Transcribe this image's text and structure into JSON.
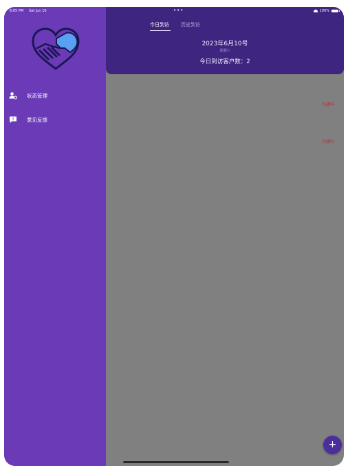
{
  "status_bar": {
    "time": "6:05 PM",
    "date": "Sat Jun 10",
    "dots": "•••",
    "battery": "100%"
  },
  "drawer": {
    "menu": [
      {
        "label": "状态管理",
        "icon": "user-settings-icon"
      },
      {
        "label": "意见反馈",
        "icon": "feedback-icon"
      }
    ],
    "logo_icon": "handshake-heart-icon"
  },
  "header": {
    "tabs": [
      {
        "label": "今日到访",
        "active": true
      },
      {
        "label": "历史到访",
        "active": false
      }
    ],
    "date": "2023年6月10号",
    "weekday": "星期六",
    "count_text": "今日到访客户数：2"
  },
  "list": {
    "items": [
      {
        "status": "沟通中"
      },
      {
        "status": "沟通中"
      }
    ]
  },
  "fab": {
    "label": "+"
  },
  "colors": {
    "drawer": "#6a3ab7",
    "header": "#3d2580",
    "overlay": "#808080",
    "status_red": "#c22a2a"
  }
}
